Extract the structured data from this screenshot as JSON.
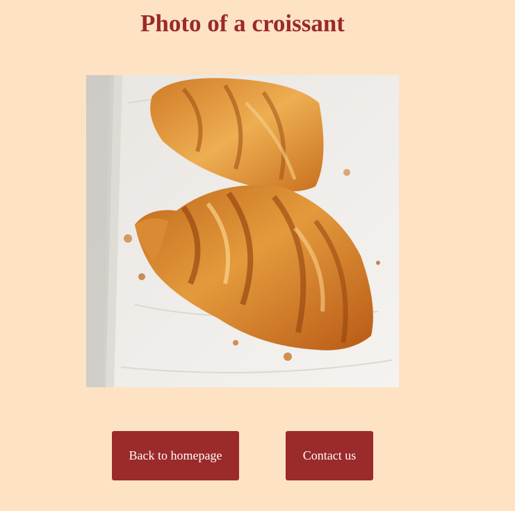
{
  "page": {
    "title": "Photo of a croissant",
    "background_color": "#fde3c4",
    "accent_color": "#9b2a2a"
  },
  "photo": {
    "subject": "croissant"
  },
  "buttons": {
    "back_label": "Back to homepage",
    "contact_label": "Contact us"
  }
}
